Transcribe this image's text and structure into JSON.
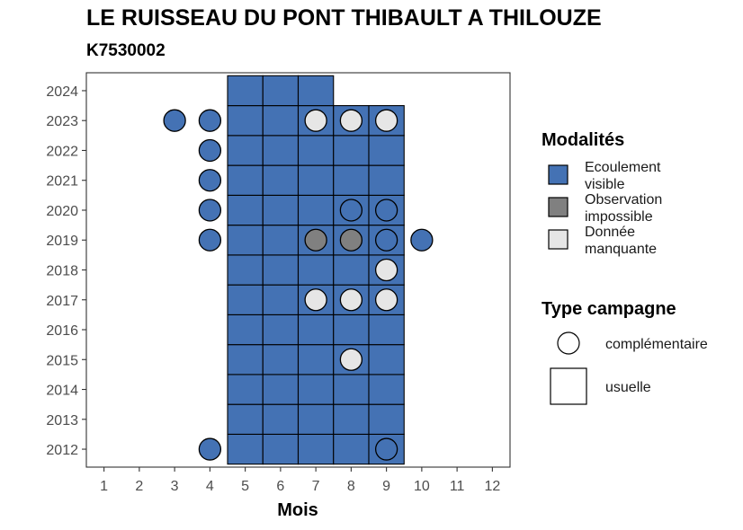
{
  "chart_data": {
    "type": "heatmap",
    "title": "LE RUISSEAU DU PONT THIBAULT A THILOUZE",
    "subtitle": "K7530002",
    "xlabel": "Mois",
    "ylabel": "",
    "x_ticks": [
      "1",
      "2",
      "3",
      "4",
      "5",
      "6",
      "7",
      "8",
      "9",
      "10",
      "11",
      "12"
    ],
    "y_ticks": [
      "2012",
      "2013",
      "2014",
      "2015",
      "2016",
      "2017",
      "2018",
      "2019",
      "2020",
      "2021",
      "2022",
      "2023",
      "2024"
    ],
    "xlim": [
      0.5,
      12.5
    ],
    "ylim": [
      2011.4,
      2024.6
    ],
    "grid": false,
    "colors": {
      "Ecoulement visible": "#4472b4",
      "Observation impossible": "#808080",
      "Donnée manquante": "#e6e6e6"
    },
    "legend_modalites": {
      "title": "Modalités",
      "items": [
        {
          "key": "Ecoulement visible",
          "lines": [
            "Ecoulement",
            "visible"
          ],
          "color": "#4472b4"
        },
        {
          "key": "Observation impossible",
          "lines": [
            "Observation",
            "impossible"
          ],
          "color": "#808080"
        },
        {
          "key": "Donnée manquante",
          "lines": [
            "Donnée",
            "manquante"
          ],
          "color": "#e6e6e6"
        }
      ]
    },
    "legend_type": {
      "title": "Type campagne",
      "items": [
        {
          "label": "complémentaire",
          "shape": "circle"
        },
        {
          "label": "usuelle",
          "shape": "square"
        }
      ]
    },
    "usuelle": [
      {
        "year": 2012,
        "months": [
          5,
          6,
          7,
          8,
          9
        ],
        "modalite": "Ecoulement visible"
      },
      {
        "year": 2013,
        "months": [
          5,
          6,
          7,
          8,
          9
        ],
        "modalite": "Ecoulement visible"
      },
      {
        "year": 2014,
        "months": [
          5,
          6,
          7,
          8,
          9
        ],
        "modalite": "Ecoulement visible"
      },
      {
        "year": 2015,
        "months": [
          5,
          6,
          7,
          8,
          9
        ],
        "modalite": "Ecoulement visible"
      },
      {
        "year": 2016,
        "months": [
          5,
          6,
          7,
          8,
          9
        ],
        "modalite": "Ecoulement visible"
      },
      {
        "year": 2017,
        "months": [
          5,
          6,
          7,
          8,
          9
        ],
        "modalite": "Ecoulement visible"
      },
      {
        "year": 2018,
        "months": [
          5,
          6,
          7,
          8,
          9
        ],
        "modalite": "Ecoulement visible"
      },
      {
        "year": 2019,
        "months": [
          5,
          6,
          7,
          8,
          9
        ],
        "modalite": "Ecoulement visible"
      },
      {
        "year": 2020,
        "months": [
          5,
          6,
          7,
          8,
          9
        ],
        "modalite": "Ecoulement visible"
      },
      {
        "year": 2021,
        "months": [
          5,
          6,
          7,
          8,
          9
        ],
        "modalite": "Ecoulement visible"
      },
      {
        "year": 2022,
        "months": [
          5,
          6,
          7,
          8,
          9
        ],
        "modalite": "Ecoulement visible"
      },
      {
        "year": 2023,
        "months": [
          5,
          6,
          7,
          8,
          9
        ],
        "modalite": "Ecoulement visible"
      },
      {
        "year": 2024,
        "months": [
          5,
          6,
          7
        ],
        "modalite": "Ecoulement visible"
      }
    ],
    "complementaire": [
      {
        "year": 2023,
        "month": 3,
        "modalite": "Ecoulement visible"
      },
      {
        "year": 2023,
        "month": 4,
        "modalite": "Ecoulement visible"
      },
      {
        "year": 2023,
        "month": 7,
        "modalite": "Donnée manquante"
      },
      {
        "year": 2023,
        "month": 8,
        "modalite": "Donnée manquante"
      },
      {
        "year": 2023,
        "month": 9,
        "modalite": "Donnée manquante"
      },
      {
        "year": 2022,
        "month": 4,
        "modalite": "Ecoulement visible"
      },
      {
        "year": 2021,
        "month": 4,
        "modalite": "Ecoulement visible"
      },
      {
        "year": 2020,
        "month": 4,
        "modalite": "Ecoulement visible"
      },
      {
        "year": 2020,
        "month": 8,
        "modalite": "Ecoulement visible"
      },
      {
        "year": 2020,
        "month": 9,
        "modalite": "Ecoulement visible"
      },
      {
        "year": 2019,
        "month": 4,
        "modalite": "Ecoulement visible"
      },
      {
        "year": 2019,
        "month": 7,
        "modalite": "Observation impossible"
      },
      {
        "year": 2019,
        "month": 8,
        "modalite": "Observation impossible"
      },
      {
        "year": 2019,
        "month": 9,
        "modalite": "Ecoulement visible"
      },
      {
        "year": 2019,
        "month": 10,
        "modalite": "Ecoulement visible"
      },
      {
        "year": 2018,
        "month": 9,
        "modalite": "Donnée manquante"
      },
      {
        "year": 2017,
        "month": 7,
        "modalite": "Donnée manquante"
      },
      {
        "year": 2017,
        "month": 8,
        "modalite": "Donnée manquante"
      },
      {
        "year": 2017,
        "month": 9,
        "modalite": "Donnée manquante"
      },
      {
        "year": 2015,
        "month": 8,
        "modalite": "Donnée manquante"
      },
      {
        "year": 2012,
        "month": 4,
        "modalite": "Ecoulement visible"
      },
      {
        "year": 2012,
        "month": 9,
        "modalite": "Ecoulement visible"
      }
    ]
  }
}
